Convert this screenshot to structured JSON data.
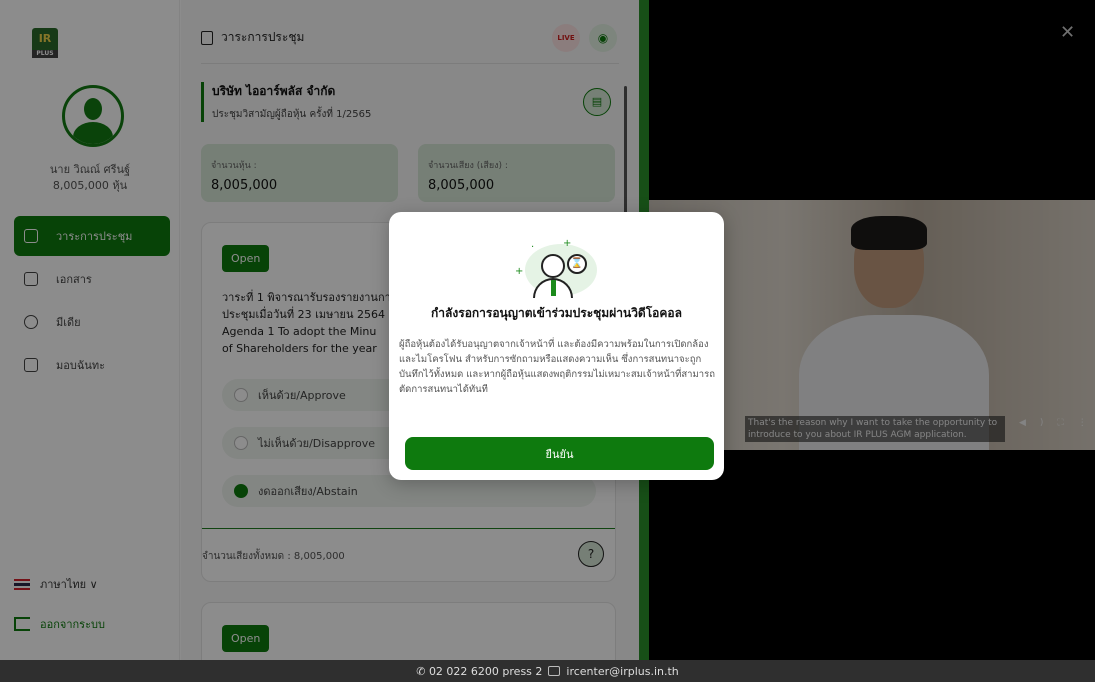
{
  "sidebar": {
    "user_name": "นาย วิณณ์ ศรีนฐ์",
    "user_shares": "8,005,000 หุ้น",
    "nav": [
      {
        "label": "วาระการประชุม",
        "active": true
      },
      {
        "label": "เอกสาร",
        "active": false
      },
      {
        "label": "มีเดีย",
        "active": false
      },
      {
        "label": "มอบฉันทะ",
        "active": false
      }
    ],
    "language": "ภาษาไทย ∨",
    "logout": "ออกจากระบบ"
  },
  "main": {
    "header_title": "วาระการประชุม",
    "live_badge": "LIVE",
    "company_name": "บริษัท ไออาร์พลัส จำกัด",
    "meeting_name": "ประชุมวิสามัญผู้ถือหุ้น ครั้งที่ 1/2565",
    "doc_icon": "doc-icon",
    "stats": [
      {
        "label": "จำนวนหุ้น :",
        "value": "8,005,000"
      },
      {
        "label": "จำนวนเสียง (เสียง) :",
        "value": "8,005,000"
      }
    ],
    "agenda": {
      "status": "Open",
      "text": "วาระที่ 1 พิจารณารับรองรายงานการ\nประชุมเมื่อวันที่ 23 เมษายน 2564\nAgenda 1 To adopt the Minu\nof Shareholders for the year",
      "options": [
        {
          "label": "เห็นด้วย/Approve",
          "selected": false
        },
        {
          "label": "ไม่เห็นด้วย/Disapprove",
          "selected": false
        },
        {
          "label": "งดออกเสียง/Abstain",
          "selected": true
        }
      ],
      "total_votes": "จำนวนเสียงทั้งหมด : 8,005,000",
      "help": "?"
    },
    "agenda2_status": "Open"
  },
  "video": {
    "close": "✕",
    "subtitle": "That's the reason why I want to take the opportunity to introduce to you about IR PLUS AGM application."
  },
  "modal": {
    "title": "กำลังรอการอนุญาตเข้าร่วมประชุมผ่านวิดีโอคอล",
    "description": "ผู้ถือหุ้นต้องได้รับอนุญาตจากเจ้าหน้าที่ และต้องมีความพร้อมในการเปิดกล้องและไมโครโฟน สำหรับการซักถามหรือแสดงความเห็น ซึ่งการสนทนาจะถูกบันทึกไว้ทั้งหมด และหากผู้ถือหุ้นแสดงพฤติกรรมไม่เหมาะสมเจ้าหน้าที่สามารถตัดการสนทนาได้ทันที",
    "confirm": "ยืนยัน"
  },
  "footer": {
    "phone": "02 022 6200 press 2",
    "email": "ircenter@irplus.in.th"
  },
  "colors": {
    "primary": "#0e7a0e",
    "live": "#d02020",
    "video_border": "#2a912a"
  }
}
